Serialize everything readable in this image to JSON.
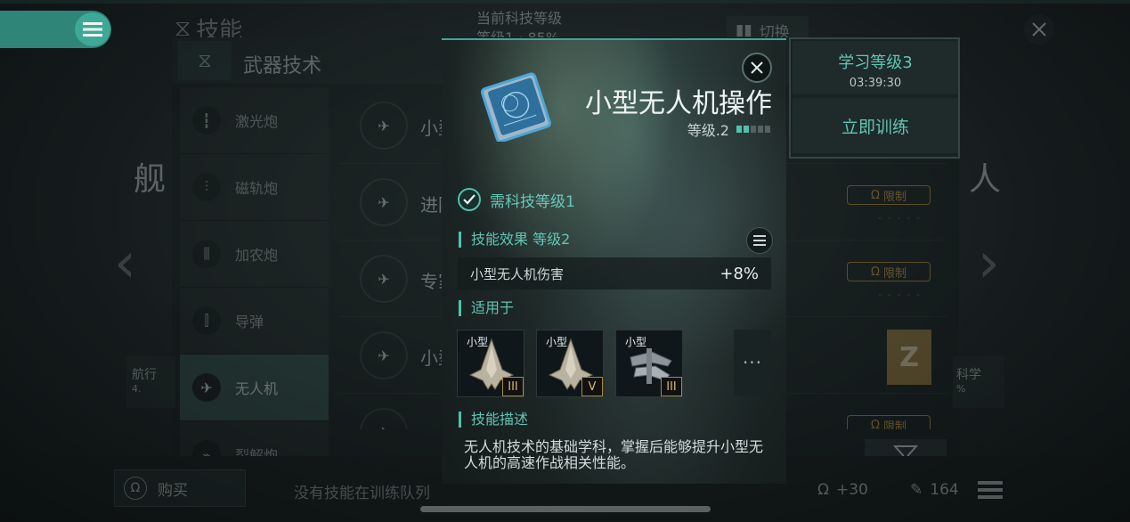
{
  "header": {
    "title": "技能",
    "top_center_line1": "当前科技等级",
    "top_center_line2": "等级1",
    "top_center_line2b": "85%",
    "switch_label": "切换"
  },
  "panel": {
    "title": "武器技术",
    "categories": [
      {
        "label": "激光炮"
      },
      {
        "label": "磁轨炮"
      },
      {
        "label": "加农炮"
      },
      {
        "label": "导弹"
      },
      {
        "label": "无人机"
      },
      {
        "label": "裂解炮"
      }
    ],
    "rows": [
      {
        "text": "小型",
        "limited": false
      },
      {
        "text": "进阶",
        "limited": true
      },
      {
        "text": "专家",
        "limited": true
      },
      {
        "text": "小型",
        "limited": false
      },
      {
        "text": "",
        "limited": true
      }
    ],
    "limit_label": "限制",
    "limit_dots": "- - - - -"
  },
  "background": {
    "left_big": "舰",
    "right_big": "人",
    "left_card_label": "航行",
    "left_card_value": "4.",
    "right_card_label": "科学",
    "right_card_value": "%",
    "z_badge": "Z"
  },
  "bottom": {
    "buy_label": "购买",
    "queue_text": "没有技能在训练队列",
    "res1_value": "+30",
    "res2_value": "164"
  },
  "training": {
    "level_label": "学习等级3",
    "time_left": "03:39:30",
    "train_now": "立即训练"
  },
  "modal": {
    "skill_name": "小型无人机操作",
    "level_text": "等级.2",
    "level_filled": 2,
    "level_total": 5,
    "requirement": "需科技等级1",
    "effect_title": "技能效果 等级2",
    "effect_name": "小型无人机伤害",
    "effect_value": "+8%",
    "applies_title": "适用于",
    "ships": [
      {
        "label": "小型",
        "tier": "III"
      },
      {
        "label": "小型",
        "tier": "V"
      },
      {
        "label": "小型",
        "tier": "III"
      }
    ],
    "more": "···",
    "desc_title": "技能描述",
    "description": "无人机技术的基础学科，掌握后能够提升小型无人机的高速作战相关性能。"
  },
  "colors": {
    "accent": "#4fc1ac",
    "limit_gold": "#c9983e",
    "menu_teal": "#3ea897"
  },
  "icons": {
    "menu": "menu-icon",
    "close": "close-icon",
    "check": "check-icon",
    "list": "list-icon",
    "filter": "filter-icon",
    "omega": "omega-icon"
  }
}
